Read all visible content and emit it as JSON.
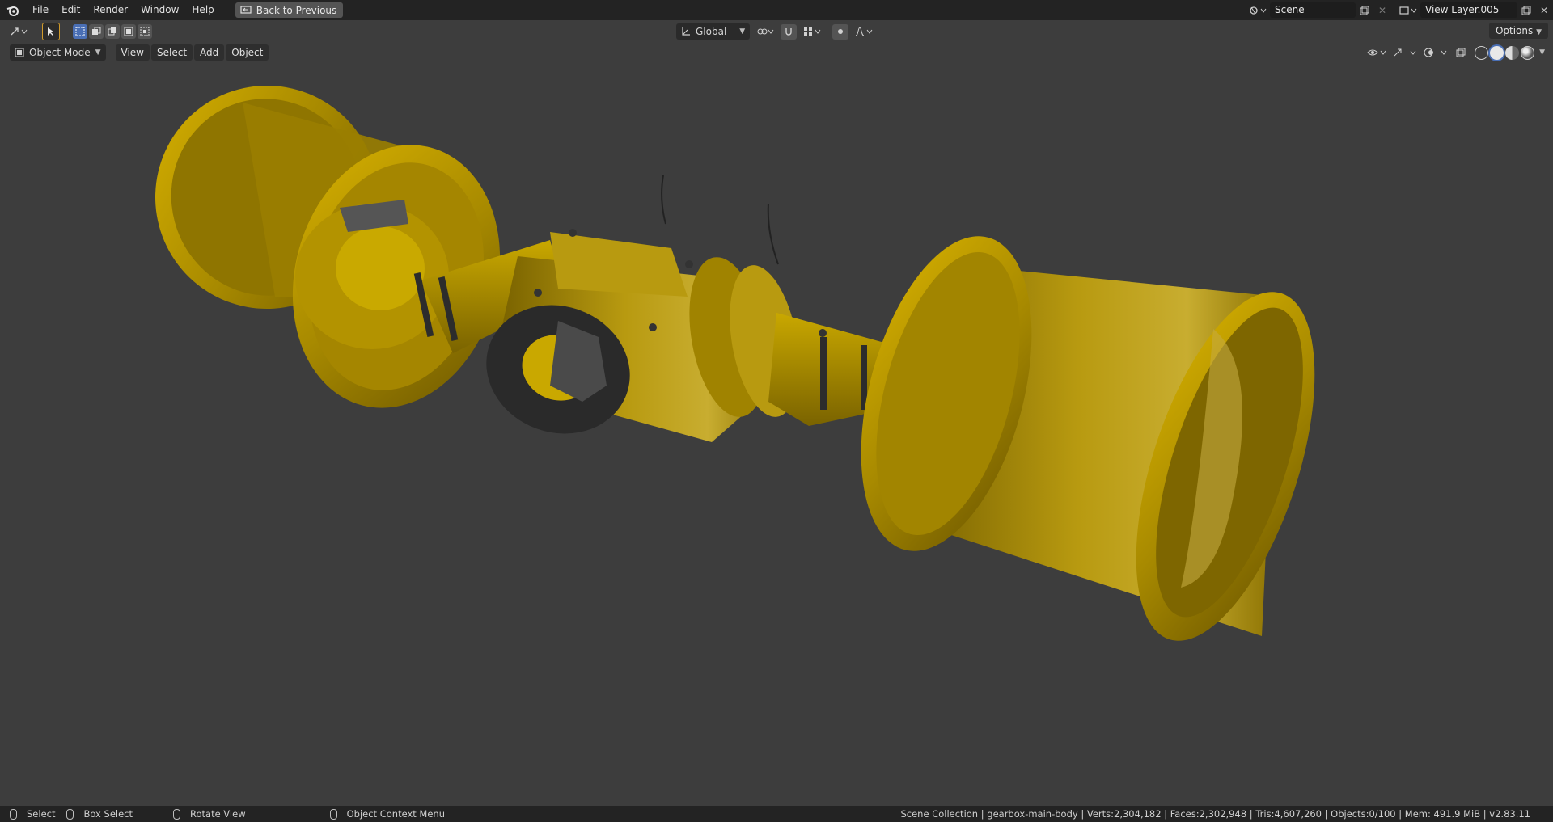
{
  "topbar": {
    "menu": [
      "File",
      "Edit",
      "Render",
      "Window",
      "Help"
    ],
    "back_button": "Back to Previous",
    "scene_name": "Scene",
    "view_layer": "View Layer.005"
  },
  "toolbar": {
    "orientation": "Global",
    "options_label": "Options"
  },
  "header": {
    "mode": "Object Mode",
    "menus": [
      "View",
      "Select",
      "Add",
      "Object"
    ]
  },
  "viewport": {
    "model_color": "#c2a200",
    "background": "#3d3d3d"
  },
  "status": {
    "select": "Select",
    "box_select": "Box Select",
    "rotate_view": "Rotate View",
    "context_menu": "Object Context Menu",
    "stats": "Scene Collection | gearbox-main-body | Verts:2,304,182 | Faces:2,302,948 | Tris:4,607,260 | Objects:0/100 | Mem: 491.9 MiB | v2.83.11"
  }
}
